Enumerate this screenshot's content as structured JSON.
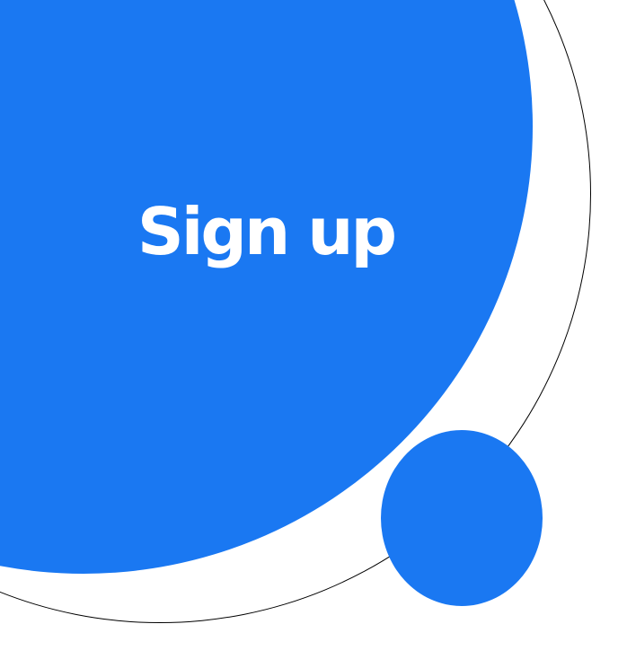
{
  "colors": {
    "accent_blue": "#1a78f2",
    "background": "#ffffff",
    "outline": "#000000",
    "title_text": "#ffffff"
  },
  "hero": {
    "title": "Sign up"
  }
}
